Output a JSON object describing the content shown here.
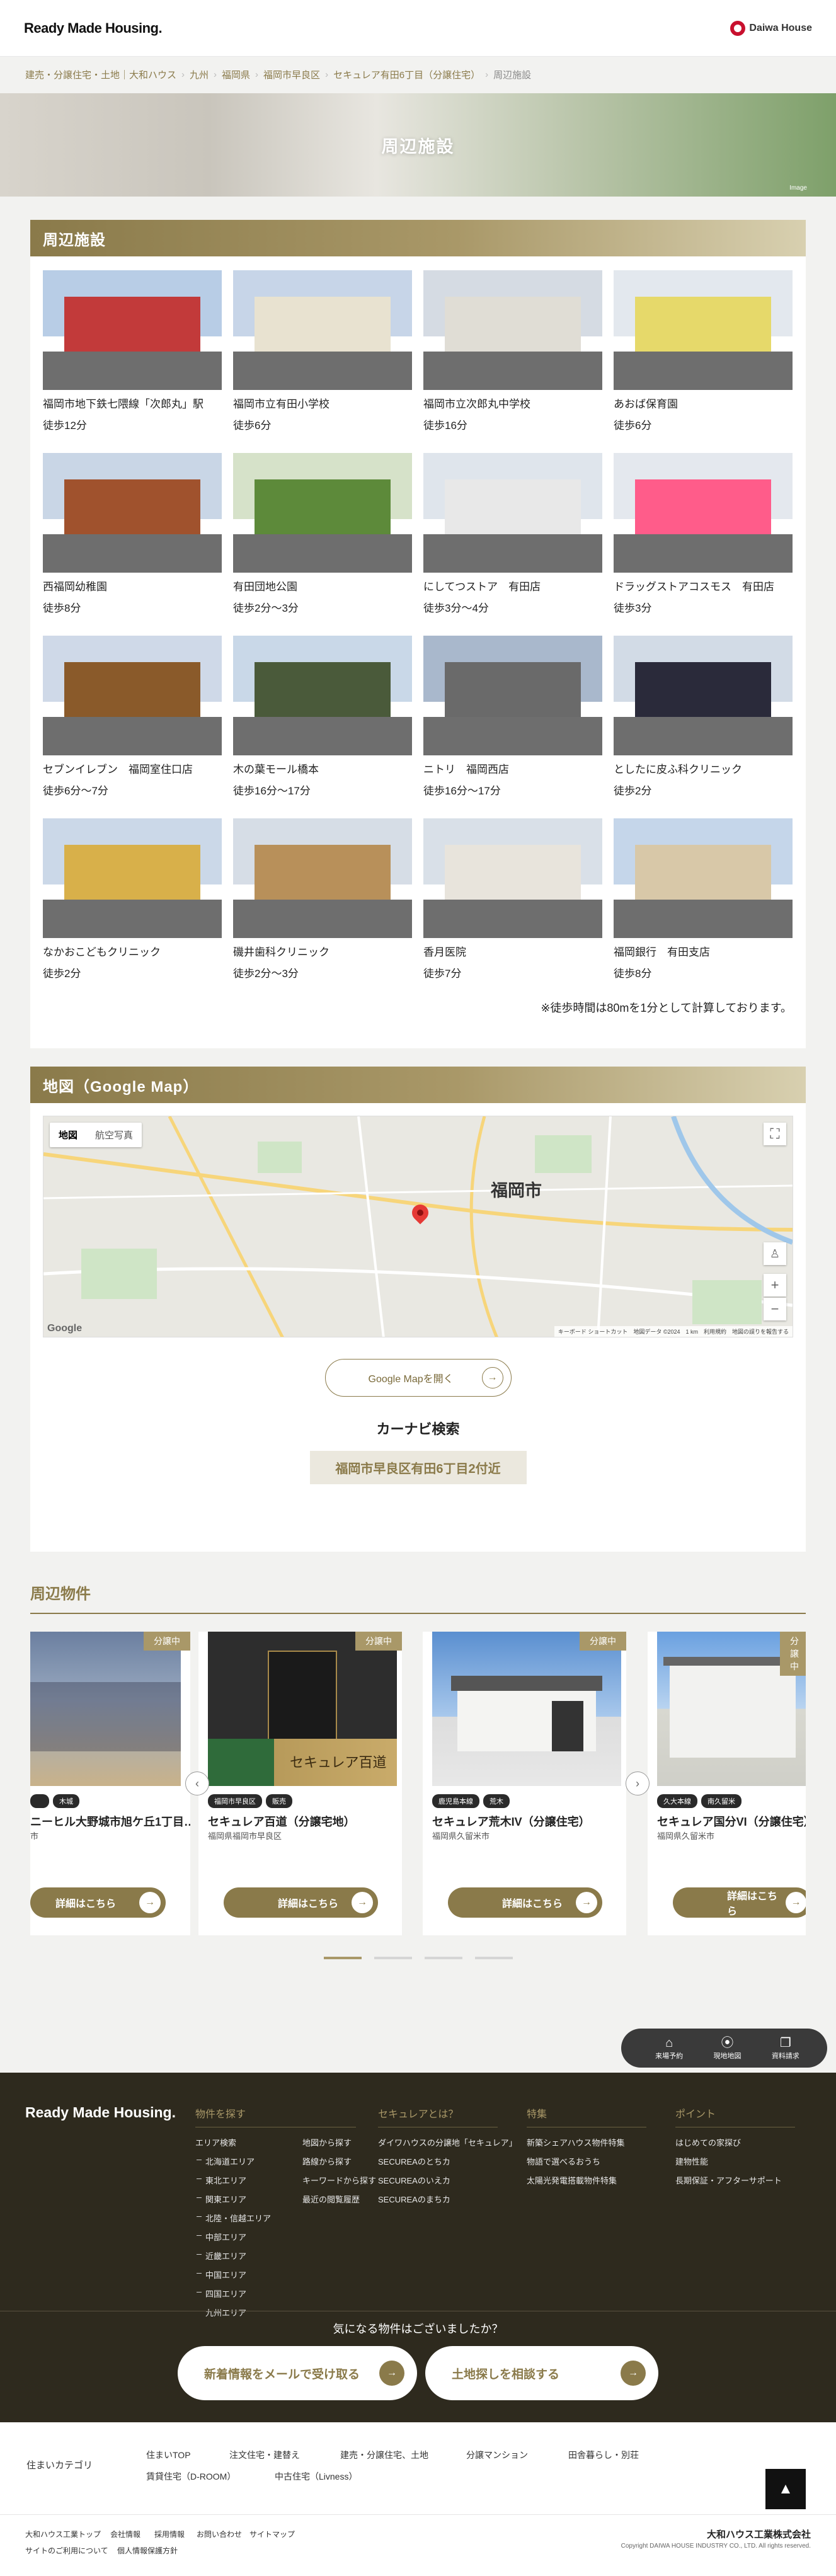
{
  "header": {
    "logo": "Ready Made Housing.",
    "brand": "Daiwa House"
  },
  "breadcrumb": [
    "建売・分譲住宅・土地｜大和ハウス",
    "九州",
    "福岡県",
    "福岡市早良区",
    "セキュレア有田6丁目（分譲住宅）",
    "周辺施設"
  ],
  "hero": {
    "title": "周辺施設",
    "image_label": "Image"
  },
  "facilities_section": {
    "title": "周辺施設",
    "items": [
      {
        "name": "福岡市地下鉄七隈線「次郎丸」駅",
        "walk": "徒歩12分"
      },
      {
        "name": "福岡市立有田小学校",
        "walk": "徒歩6分"
      },
      {
        "name": "福岡市立次郎丸中学校",
        "walk": "徒歩16分"
      },
      {
        "name": "あおば保育園",
        "walk": "徒歩6分"
      },
      {
        "name": "西福岡幼稚園",
        "walk": "徒歩8分"
      },
      {
        "name": "有田団地公園",
        "walk": "徒歩2分〜3分"
      },
      {
        "name": "にしてつストア　有田店",
        "walk": "徒歩3分〜4分"
      },
      {
        "name": "ドラッグストアコスモス　有田店",
        "walk": "徒歩3分"
      },
      {
        "name": "セブンイレブン　福岡室住口店",
        "walk": "徒歩6分〜7分"
      },
      {
        "name": "木の葉モール橋本",
        "walk": "徒歩16分〜17分"
      },
      {
        "name": "ニトリ　福岡西店",
        "walk": "徒歩16分〜17分"
      },
      {
        "name": "としたに皮ふ科クリニック",
        "walk": "徒歩2分"
      },
      {
        "name": "なかおこどもクリニック",
        "walk": "徒歩2分"
      },
      {
        "name": "磯井歯科クリニック",
        "walk": "徒歩2分〜3分"
      },
      {
        "name": "香月医院",
        "walk": "徒歩7分"
      },
      {
        "name": "福岡銀行　有田支店",
        "walk": "徒歩8分"
      }
    ],
    "note": "※徒歩時間は80mを1分として計算しております。"
  },
  "map_section": {
    "title": "地図（Google Map）",
    "tab_map": "地図",
    "tab_satellite": "航空写真",
    "city_label": "福岡市",
    "map_footer": "キーボード ショートカット　地図データ ©2024　1 km　利用規約　地図の誤りを報告する",
    "google_label": "Google",
    "open_button": "Google Mapを開く",
    "carnavi_title": "カーナビ検索",
    "carnavi_address": "福岡市早良区有田6丁目2付近"
  },
  "nearby": {
    "title": "周辺物件",
    "items": [
      {
        "badge": "分譲中",
        "tags": [
          "",
          "木城"
        ],
        "name": "ニーヒル大野城市旭ケ丘1丁目…",
        "loc": "市",
        "button": "詳細はこちら"
      },
      {
        "badge": "分譲中",
        "tags": [
          "福岡市早良区",
          "販売"
        ],
        "name": "セキュレア百道（分譲宅地）",
        "loc": "福岡県福岡市早良区",
        "button": "詳細はこちら",
        "img_text": "セキュレア百道"
      },
      {
        "badge": "分譲中",
        "tags": [
          "鹿児島本線",
          "荒木"
        ],
        "name": "セキュレア荒木IV（分譲住宅）",
        "loc": "福岡県久留米市",
        "button": "詳細はこちら"
      },
      {
        "badge": "分譲中",
        "tags": [
          "久大本線",
          "南久留米"
        ],
        "name": "セキュレア国分VI（分譲住宅）",
        "loc": "福岡県久留米市",
        "button": "詳細はこちら"
      }
    ],
    "prev_arrow": "‹",
    "next_arrow": "›"
  },
  "float_bar": [
    {
      "icon": "⌂",
      "label": "来場予約"
    },
    {
      "icon": "⦿",
      "label": "現地地図"
    },
    {
      "icon": "❐",
      "label": "資料請求"
    }
  ],
  "footer": {
    "logo": "Ready Made Housing.",
    "col1": {
      "title": "物件を探す",
      "areas_title": "エリア検索",
      "areas": [
        "北海道エリア",
        "東北エリア",
        "関東エリア",
        "北陸・信越エリア",
        "中部エリア",
        "近畿エリア",
        "中国エリア",
        "四国エリア",
        "九州エリア"
      ],
      "other": [
        "地図から探す",
        "路線から探す",
        "キーワードから探す",
        "最近の閲覧履歴"
      ]
    },
    "col2": {
      "title": "セキュレアとは？",
      "links": [
        "ダイワハウスの分譲地「セキュレア」",
        "SECUREAのとちカ",
        "SECUREAのいえカ",
        "SECUREAのまちカ"
      ]
    },
    "col3": {
      "title": "特集",
      "links": [
        "新築シェアハウス物件特集",
        "物語で選べるおうち",
        "太陽光発電搭載物件特集"
      ]
    },
    "col4": {
      "title": "ポイント",
      "links": [
        "はじめての家探び",
        "建物性能",
        "長期保証・アフターサポート"
      ]
    },
    "cta_question": "気になる物件はございましたか？",
    "cta_mail": "新着情報をメールで受け取る",
    "cta_land": "土地探しを相談する"
  },
  "categories": {
    "label": "住まいカテゴリ",
    "links": [
      "住まいTOP",
      "注文住宅・建替え",
      "建売・分譲住宅、土地",
      "分譲マンション",
      "田舎暮らし・別荘",
      "賃貸住宅（D-ROOM）",
      "中古住宅（Livness）"
    ],
    "to_top": "▲"
  },
  "bottom": {
    "links": [
      "大和ハウス工業トップ",
      "会社情報",
      "採用情報",
      "お問い合わせ",
      "サイトマップ",
      "サイトのご利用について",
      "個人情報保護方針"
    ],
    "corp": "大和ハウス工業株式会社",
    "copyright": "Copyright DAIWA HOUSE INDUSTRY CO., LTD. All rights reserved."
  },
  "colors": {
    "accent": "#8a7a4a",
    "accent_light": "#a99868",
    "footer_bg": "#2e2a1e"
  }
}
